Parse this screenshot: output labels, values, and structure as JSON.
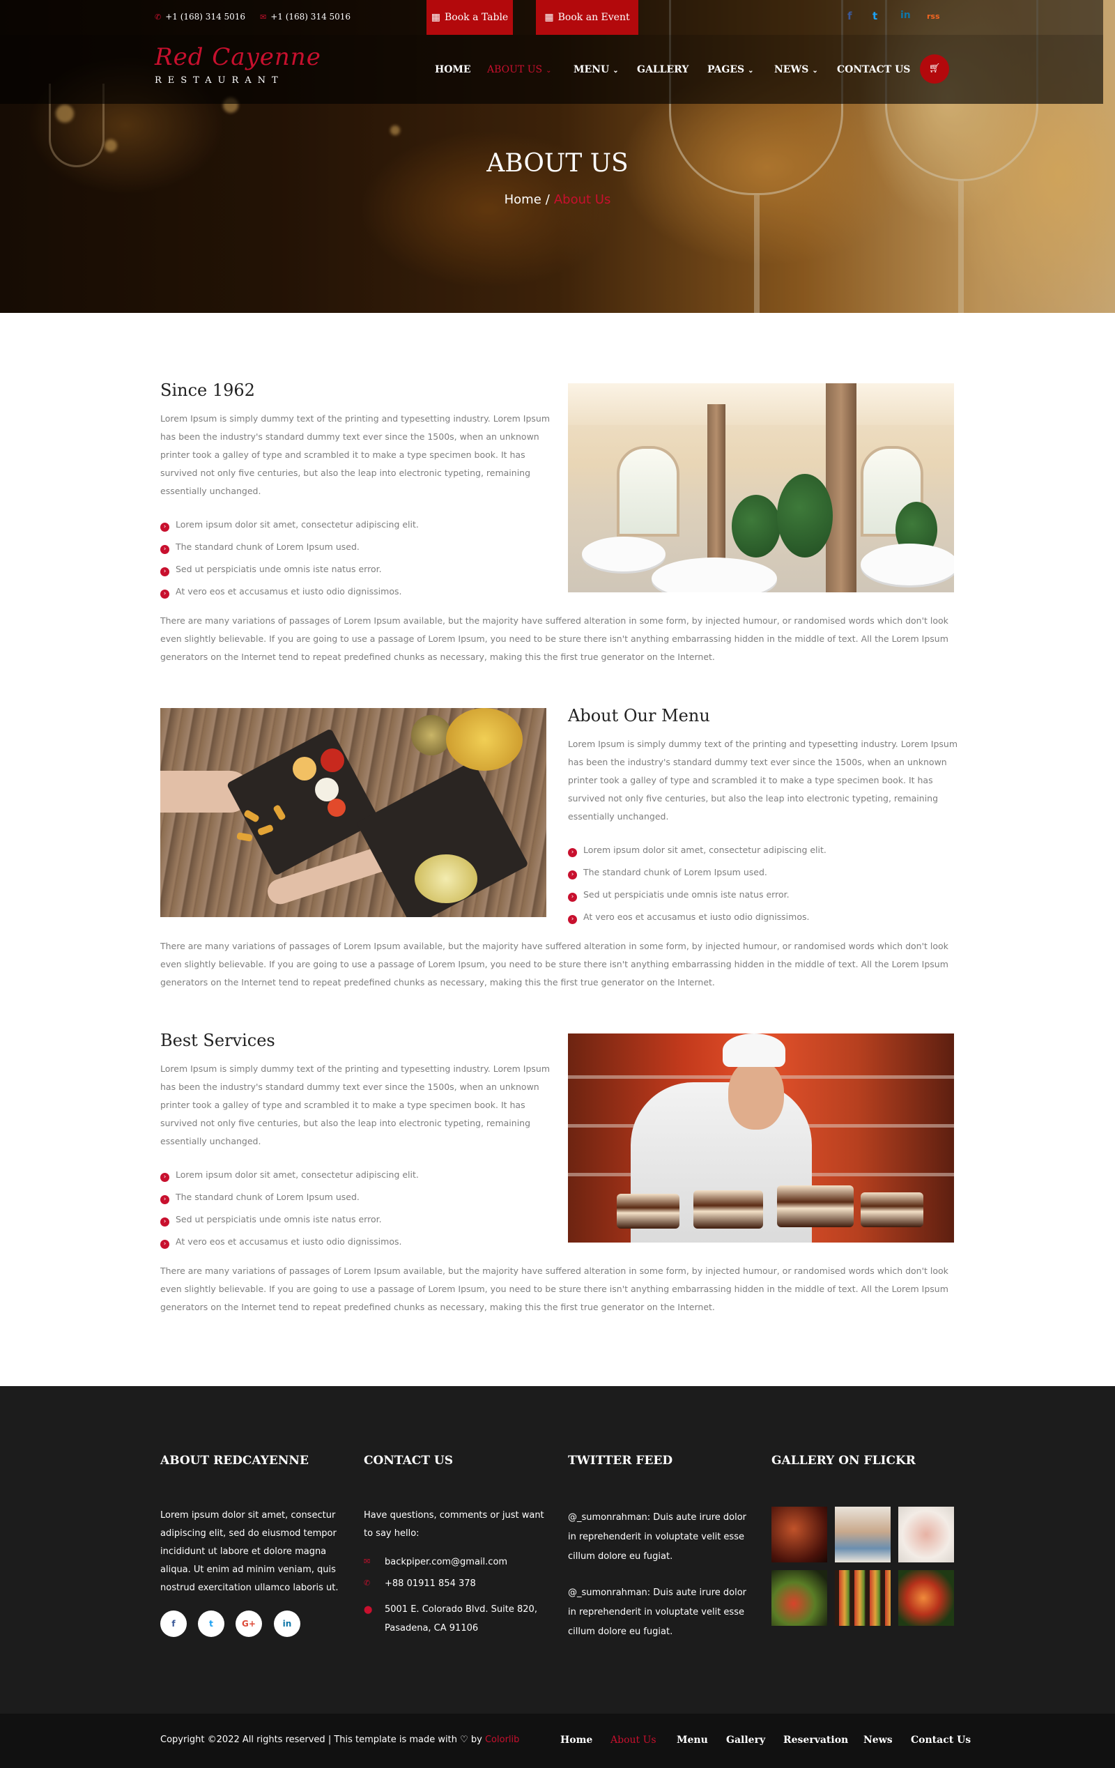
{
  "topbar": {
    "phone_1": "+1 (168) 314 5016",
    "phone_2": "+1 (168) 314 5016",
    "book_table": "Book a Table",
    "book_event": "Book an Event",
    "social": [
      "f",
      "t",
      "in",
      "rss"
    ]
  },
  "logo": {
    "script": "Red Cayenne",
    "sub": "RESTAURANT"
  },
  "nav": {
    "items": [
      {
        "label": "HOME",
        "active": false,
        "dropdown": false
      },
      {
        "label": "ABOUT US",
        "active": true,
        "dropdown": true
      },
      {
        "label": "MENU",
        "active": false,
        "dropdown": true
      },
      {
        "label": "GALLERY",
        "active": false,
        "dropdown": false
      },
      {
        "label": "PAGES",
        "active": false,
        "dropdown": true
      },
      {
        "label": "NEWS",
        "active": false,
        "dropdown": true
      },
      {
        "label": "CONTACT US",
        "active": false,
        "dropdown": false
      }
    ],
    "cart_icon": "cart-icon"
  },
  "hero": {
    "title": "ABOUT US",
    "crumb_home": "Home",
    "crumb_sep": "/",
    "crumb_current": "About Us"
  },
  "sections": [
    {
      "title": "Since 1962",
      "para": "Lorem Ipsum is simply dummy text of the printing and typesetting industry. Lorem Ipsum has been the industry's standard dummy text ever since the 1500s, when an unknown printer took a galley of type and scrambled it to make a type specimen book. It has survived not only five centuries, but also the leap into electronic typeting, remaining essentially unchanged.",
      "bullets": [
        "Lorem ipsum dolor sit amet, consectetur adipiscing elit.",
        "The standard chunk of Lorem Ipsum used.",
        "Sed ut perspiciatis unde omnis iste natus error.",
        "At vero eos et accusamus et iusto odio dignissimos."
      ],
      "full": "There are many variations of passages of Lorem Ipsum available, but the majority have suffered alteration in some form, by injected humour, or randomised words which don't look even slightly believable. If you are going to use a passage of Lorem Ipsum, you need to be sture there isn't anything embarrassing hidden in the middle of text. All the Lorem Ipsum generators on the Internet tend to repeat predefined chunks as necessary, making this the first true generator on the Internet."
    },
    {
      "title": "About Our Menu",
      "para": "Lorem Ipsum is simply dummy text of the printing and typesetting industry. Lorem Ipsum has been the industry's standard dummy text ever since the 1500s, when an unknown printer took a galley of type and scrambled it to make a type specimen book. It has survived not only five centuries, but also the leap into electronic typeting, remaining essentially unchanged.",
      "bullets": [
        "Lorem ipsum dolor sit amet, consectetur adipiscing elit.",
        "The standard chunk of Lorem Ipsum used.",
        "Sed ut perspiciatis unde omnis iste natus error.",
        "At vero eos et accusamus et iusto odio dignissimos."
      ],
      "full": "There are many variations of passages of Lorem Ipsum available, but the majority have suffered alteration in some form, by injected humour, or randomised words which don't look even slightly believable. If you are going to use a passage of Lorem Ipsum, you need to be sture there isn't anything embarrassing hidden in the middle of text. All the Lorem Ipsum generators on the Internet tend to repeat predefined chunks as necessary, making this the first true generator on the Internet."
    },
    {
      "title": "Best Services",
      "para": "Lorem Ipsum is simply dummy text of the printing and typesetting industry. Lorem Ipsum has been the industry's standard dummy text ever since the 1500s, when an unknown printer took a galley of type and scrambled it to make a type specimen book. It has survived not only five centuries, but also the leap into electronic typeting, remaining essentially unchanged.",
      "bullets": [
        "Lorem ipsum dolor sit amet, consectetur adipiscing elit.",
        "The standard chunk of Lorem Ipsum used.",
        "Sed ut perspiciatis unde omnis iste natus error.",
        "At vero eos et accusamus et iusto odio dignissimos."
      ],
      "full": "There are many variations of passages of Lorem Ipsum available, but the majority have suffered alteration in some form, by injected humour, or randomised words which don't look even slightly believable. If you are going to use a passage of Lorem Ipsum, you need to be sture there isn't anything embarrassing hidden in the middle of text. All the Lorem Ipsum generators on the Internet tend to repeat predefined chunks as necessary, making this the first true generator on the Internet."
    }
  ],
  "footer": {
    "about": {
      "title": "ABOUT REDCAYENNE",
      "text": "Lorem ipsum dolor sit amet, consectur adipiscing elit, sed do eiusmod tempor incididunt ut labore et dolore magna aliqua. Ut enim ad minim veniam, quis nostrud exercitation ullamco laboris ut.",
      "social": [
        "f",
        "t",
        "G+",
        "in"
      ]
    },
    "contact": {
      "title": "CONTACT US",
      "intro": "Have questions, comments or just want to say hello:",
      "email": "backpiper.com@gmail.com",
      "phone": "+88 01911 854 378",
      "address_1": "5001 E. Colorado Blvd. Suite 820,",
      "address_2": "Pasadena, CA 91106"
    },
    "twitter": {
      "title": "TWITTER FEED",
      "tweets": [
        "@_sumonrahman: Duis aute irure dolor in reprehenderit in voluptate velit esse cillum dolore eu fugiat.",
        "@_sumonrahman: Duis aute irure dolor in reprehenderit in voluptate velit esse cillum dolore eu fugiat."
      ]
    },
    "gallery": {
      "title": "GALLERY ON FLICKR"
    }
  },
  "bottombar": {
    "copyright_pre": "Copyright ©2022 All rights reserved | This template is made with",
    "heart": "♡",
    "by": "by",
    "brand": "Colorlib",
    "links": [
      {
        "label": "Home",
        "active": false
      },
      {
        "label": "About Us",
        "active": true
      },
      {
        "label": "Menu",
        "active": false
      },
      {
        "label": "Gallery",
        "active": false
      },
      {
        "label": "Reservation",
        "active": false
      },
      {
        "label": "News",
        "active": false
      },
      {
        "label": "Contact Us",
        "active": false
      }
    ]
  },
  "colors": {
    "accent": "#c8102e",
    "button": "#b3090c",
    "footer_bg": "#1c1c1c",
    "bottom_bg": "#111111"
  }
}
